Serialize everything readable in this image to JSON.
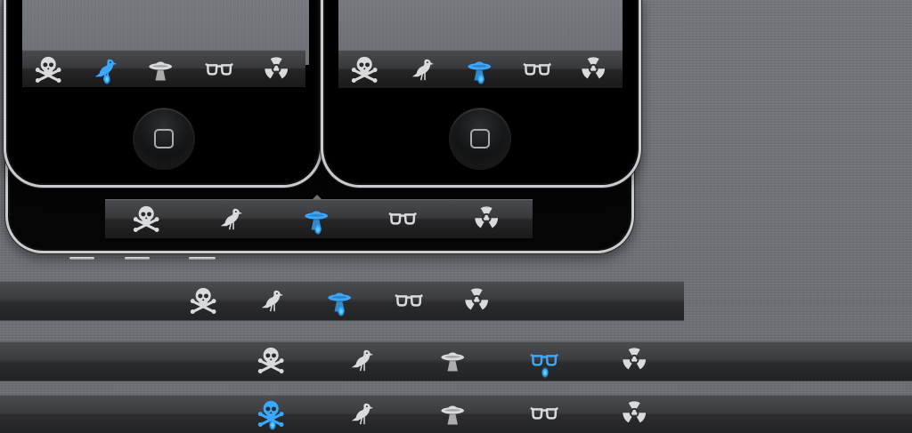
{
  "tab_icons": [
    "skull-crossbones",
    "bird",
    "ufo",
    "glasses",
    "radiation"
  ],
  "colors": {
    "icon_default": "#d9dadc",
    "icon_selected": "#3aa8ff",
    "glow": "#2aa7ff",
    "linen": "#6e7177"
  },
  "tabbars": [
    {
      "id": "phone-left-tabbar",
      "selected": "bird"
    },
    {
      "id": "phone-right-tabbar",
      "selected": "ufo"
    },
    {
      "id": "landscape-tabbar",
      "selected": "ufo"
    },
    {
      "id": "wide-tabbar-1",
      "selected": "ufo"
    },
    {
      "id": "wide-tabbar-2",
      "selected": "glasses"
    },
    {
      "id": "wide-tabbar-3",
      "selected": "skull-crossbones"
    }
  ]
}
